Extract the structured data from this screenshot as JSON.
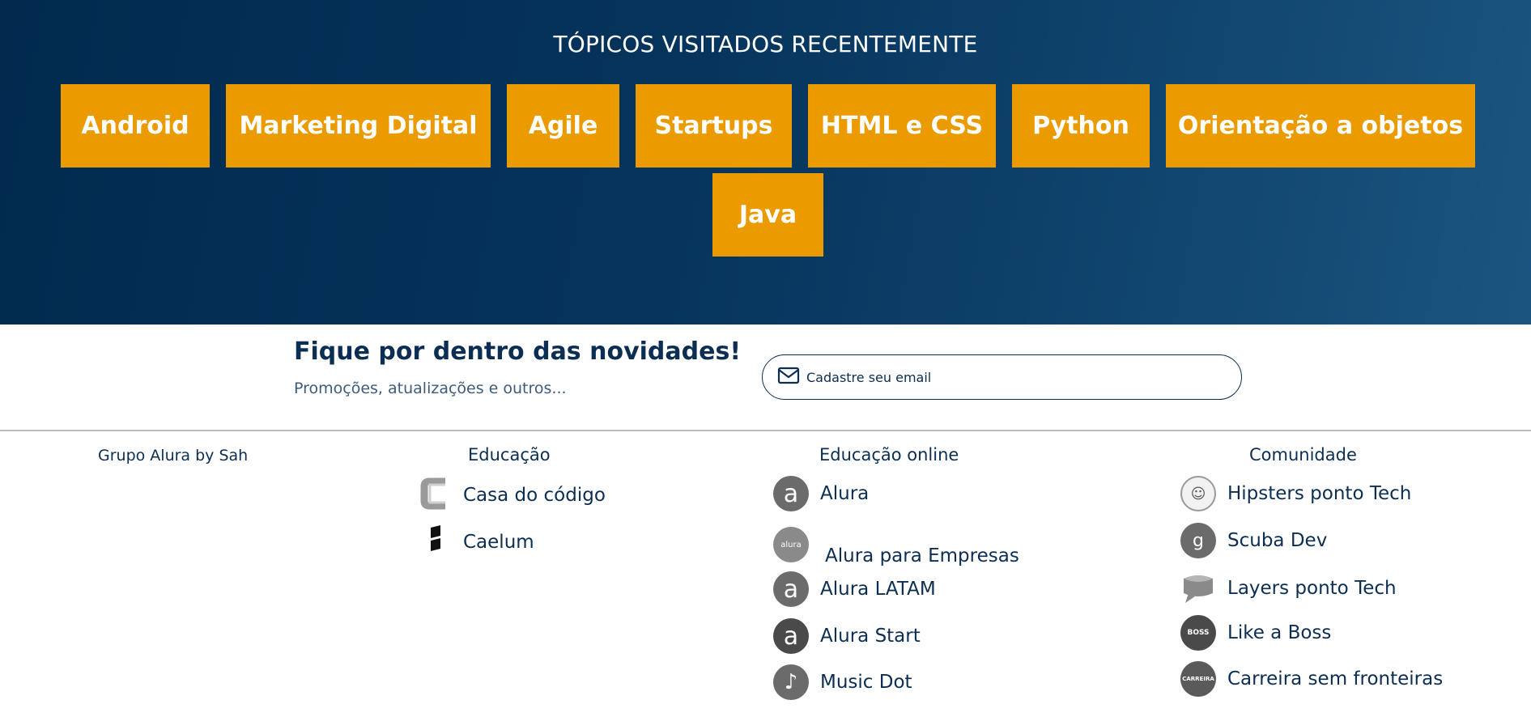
{
  "hero": {
    "title": "TÓPICOS VISITADOS RECENTEMENTE",
    "topics": [
      "Android",
      "Marketing Digital",
      "Agile",
      "Startups",
      "HTML e CSS",
      "Python",
      "Orientação a objetos",
      "Java"
    ],
    "accent": "#eb9b00"
  },
  "newsletter": {
    "title": "Fique por dentro das novidades!",
    "subtitle": "Promoções, atualizações e outros...",
    "email_placeholder": "Cadastre seu email",
    "icon": "mail-icon"
  },
  "footer": {
    "brand": "Grupo Alura by Sah",
    "columns": [
      {
        "heading": "Educação",
        "items": [
          {
            "label": "Casa do código",
            "icon": "casa-do-codigo-logo-icon"
          },
          {
            "label": "Caelum",
            "icon": "caelum-logo-icon"
          }
        ]
      },
      {
        "heading": "Educação online",
        "items": [
          {
            "label": "Alura",
            "icon": "alura-logo-icon"
          },
          {
            "label": "Alura para Empresas",
            "icon": "alura-empresas-logo-icon"
          },
          {
            "label": "Alura LATAM",
            "icon": "alura-latam-logo-icon"
          },
          {
            "label": "Alura Start",
            "icon": "alura-start-logo-icon"
          },
          {
            "label": "Music Dot",
            "icon": "music-note-icon"
          }
        ]
      },
      {
        "heading": "Comunidade",
        "items": [
          {
            "label": "Hipsters ponto Tech",
            "icon": "hipsters-logo-icon"
          },
          {
            "label": "Scuba Dev",
            "icon": "scuba-dev-logo-icon"
          },
          {
            "label": "Layers ponto Tech",
            "icon": "layers-logo-icon"
          },
          {
            "label": "Like a Boss",
            "icon": "like-a-boss-logo-icon"
          },
          {
            "label": "Carreira sem fronteiras",
            "icon": "carreira-logo-icon"
          }
        ]
      }
    ]
  }
}
